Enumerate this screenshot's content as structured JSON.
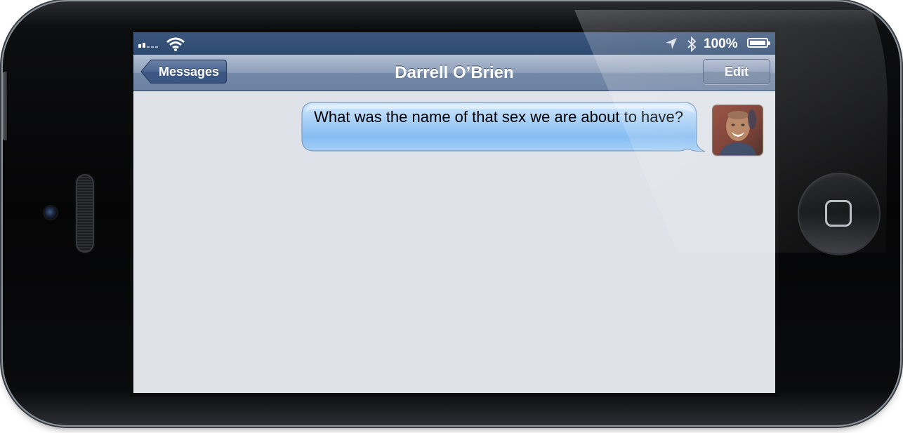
{
  "status_bar": {
    "signal_icon": "cellular-signal-icon",
    "wifi_icon": "wifi-icon",
    "location_icon": "location-arrow-icon",
    "bluetooth_icon": "bluetooth-icon",
    "battery_percent": "100%",
    "battery_icon": "battery-icon"
  },
  "nav": {
    "back_label": "Messages",
    "title": "Darrell O’Brien",
    "edit_label": "Edit"
  },
  "messages": [
    {
      "text": "What was the name of that sex we are about to have?",
      "sender": "Darrell O’Brien",
      "direction": "incoming"
    }
  ],
  "colors": {
    "bubble": "#a9d2f8",
    "nav_bar": "#8e9fb9",
    "status_bar": "#2e4a70",
    "background": "#dfe2e8"
  },
  "device": {
    "home_button_icon": "home-button-icon",
    "camera_icon": "front-camera-icon",
    "speaker_icon": "earpiece-speaker-icon"
  }
}
